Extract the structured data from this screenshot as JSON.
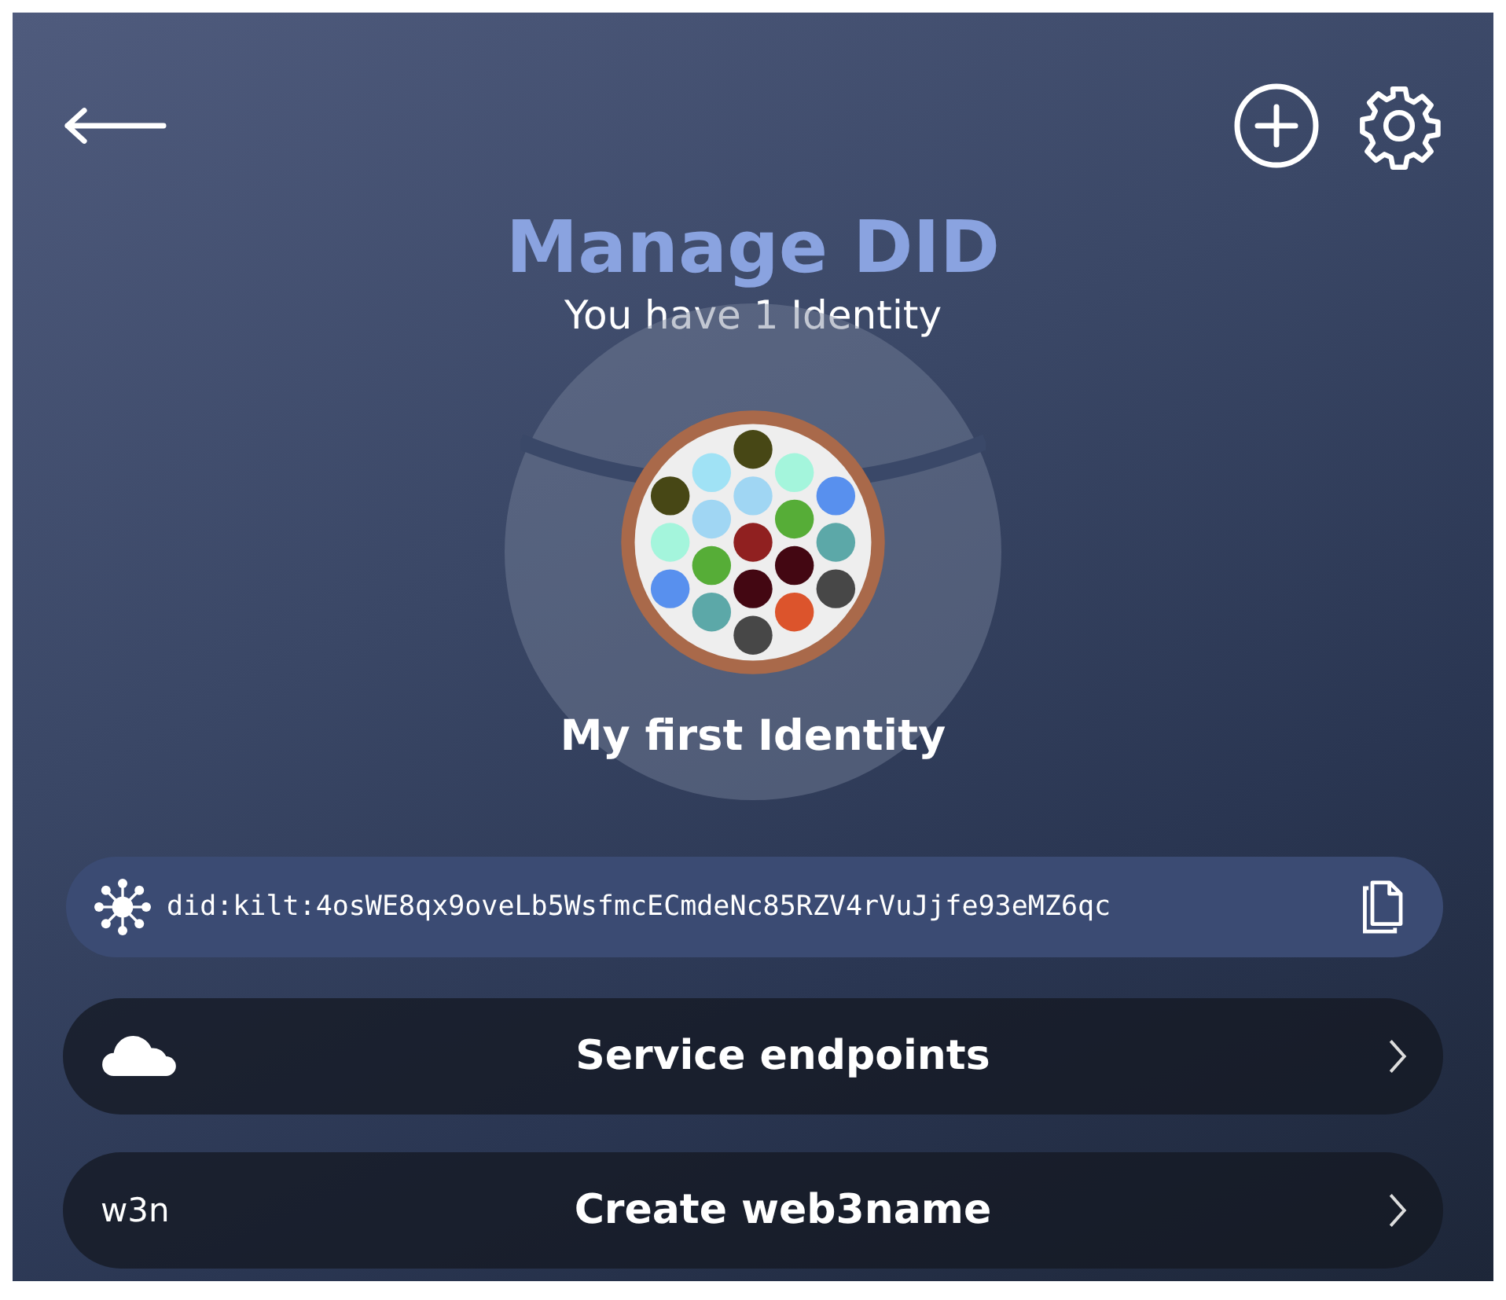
{
  "header": {
    "title": "Manage DID",
    "subtitle": "You have 1 Identity"
  },
  "identity": {
    "name": "My first Identity",
    "avatar_dots": [
      {
        "color": "#474715"
      },
      {
        "color": "#a0e2f5"
      },
      {
        "color": "#a4f5dc"
      },
      {
        "color": "#474715"
      },
      {
        "color": "#a0d6f3"
      },
      {
        "color": "#5890ee"
      },
      {
        "color": "#a0d6f3"
      },
      {
        "color": "#56ad37"
      },
      {
        "color": "#a4f5dc"
      },
      {
        "color": "#902020"
      },
      {
        "color": "#5ca8a8"
      },
      {
        "color": "#56ad37"
      },
      {
        "color": "#430712"
      },
      {
        "color": "#5890ee"
      },
      {
        "color": "#430712"
      },
      {
        "color": "#474747"
      },
      {
        "color": "#5ca8a8"
      },
      {
        "color": "#dc542c"
      },
      {
        "color": "#474747"
      }
    ]
  },
  "did": {
    "value": "did:kilt:4osWE8qx9oveLb5WsfmcECmdeNc85RZV4rVuJjfe93eMZ6qc"
  },
  "menu": [
    {
      "kind": "cloud",
      "label": "Service endpoints"
    },
    {
      "kind": "w3n",
      "icon_text": "w3n",
      "label": "Create web3name"
    }
  ]
}
